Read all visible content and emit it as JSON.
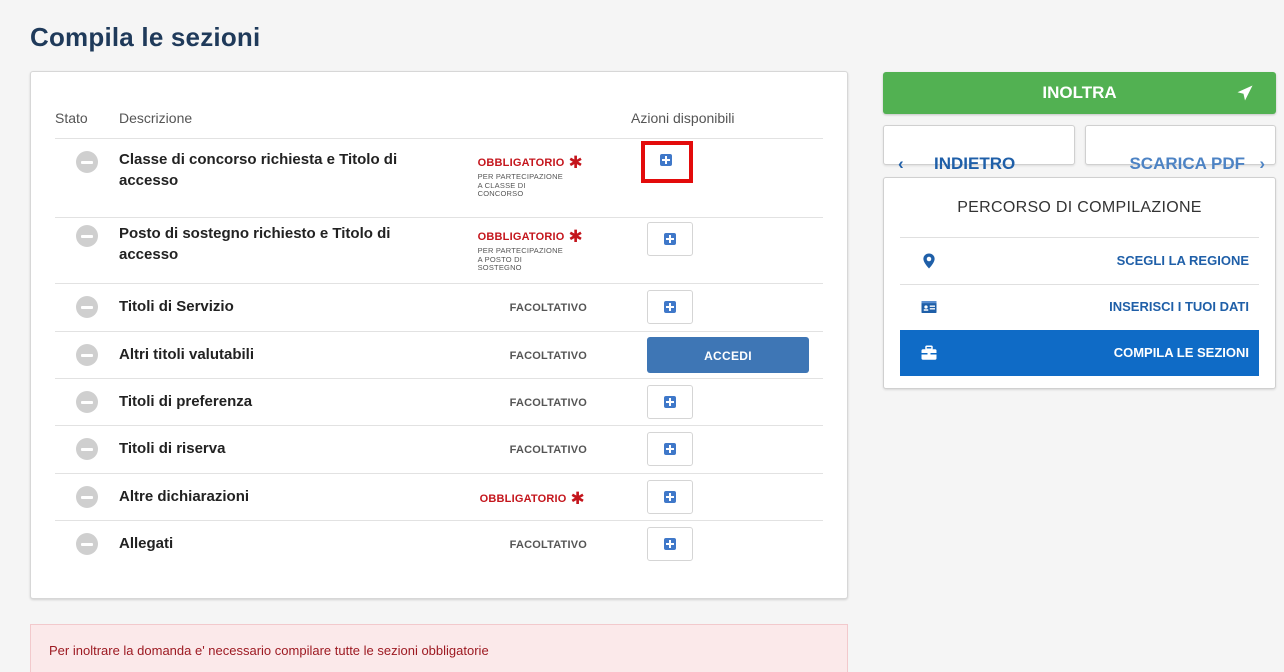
{
  "page": {
    "title": "Compila le sezioni"
  },
  "table": {
    "headers": {
      "stato": "Stato",
      "descrizione": "Descrizione",
      "azioni": "Azioni disponibili"
    },
    "rows": [
      {
        "label": "Classe di concorso richiesta e Titolo di accesso",
        "status": "OBBLIGATORIO",
        "note": "PER PARTECIPAZIONE A CLASSE DI CONCORSO",
        "action": "+"
      },
      {
        "label": "Posto di sostegno richiesto e Titolo di accesso",
        "status": "OBBLIGATORIO",
        "note": "PER PARTECIPAZIONE A POSTO DI SOSTEGNO",
        "action": "+"
      },
      {
        "label": "Titoli di Servizio",
        "status": "FACOLTATIVO",
        "action": "+"
      },
      {
        "label": "Altri titoli valutabili",
        "status": "FACOLTATIVO",
        "action": "ACCEDI"
      },
      {
        "label": "Titoli di preferenza",
        "status": "FACOLTATIVO",
        "action": "+"
      },
      {
        "label": "Titoli di riserva",
        "status": "FACOLTATIVO",
        "action": "+"
      },
      {
        "label": "Altre dichiarazioni",
        "status": "OBBLIGATORIO",
        "action": "+"
      },
      {
        "label": "Allegati",
        "status": "FACOLTATIVO",
        "action": "+"
      }
    ]
  },
  "alert": {
    "text": "Per inoltrare la domanda e' necessario compilare tutte le sezioni obbligatorie"
  },
  "sidebar": {
    "inoltra_label": "INOLTRA",
    "back_label": "INDIETRO",
    "pdf_label": "SCARICA PDF",
    "percorso_title": "PERCORSO DI COMPILAZIONE",
    "steps": [
      {
        "label": "SCEGLI LA REGIONE",
        "icon": "map-pin-icon",
        "active": false
      },
      {
        "label": "INSERISCI I TUOI DATI",
        "icon": "id-card-icon",
        "active": false
      },
      {
        "label": "COMPILA LE SEZIONI",
        "icon": "briefcase-icon",
        "active": true
      }
    ]
  },
  "colors": {
    "title": "#1f3a5a",
    "inoltra_bg": "#52b152",
    "link_blue": "#1f5fa8",
    "active_blue": "#0f6bc6",
    "required_red": "#c4151c",
    "highlight_red": "#e30b0b"
  }
}
